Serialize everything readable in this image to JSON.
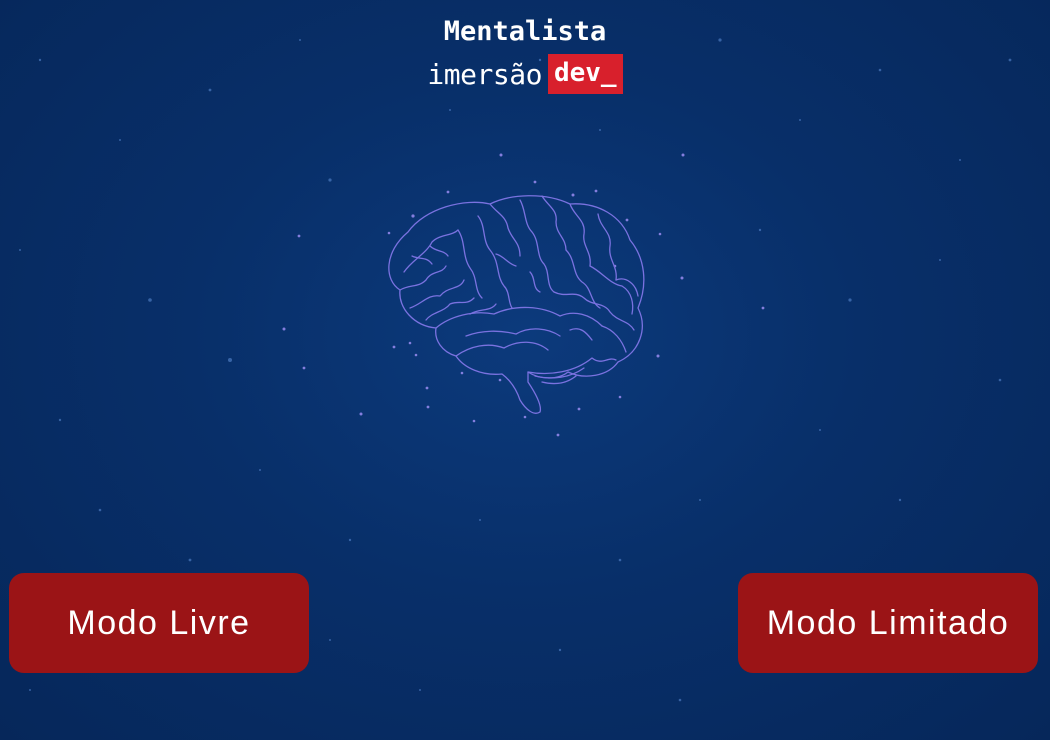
{
  "header": {
    "title": "Mentalista",
    "subtitle_word": "imersão",
    "subtitle_badge": "dev_"
  },
  "buttons": {
    "free_mode": "Modo Livre",
    "limited_mode": "Modo Limitado"
  },
  "colors": {
    "background": "#082f69",
    "badge": "#d8202c",
    "button": "#9b1416",
    "brain_stroke": "#7a72e0"
  },
  "icons": {
    "brain": "brain-icon"
  }
}
